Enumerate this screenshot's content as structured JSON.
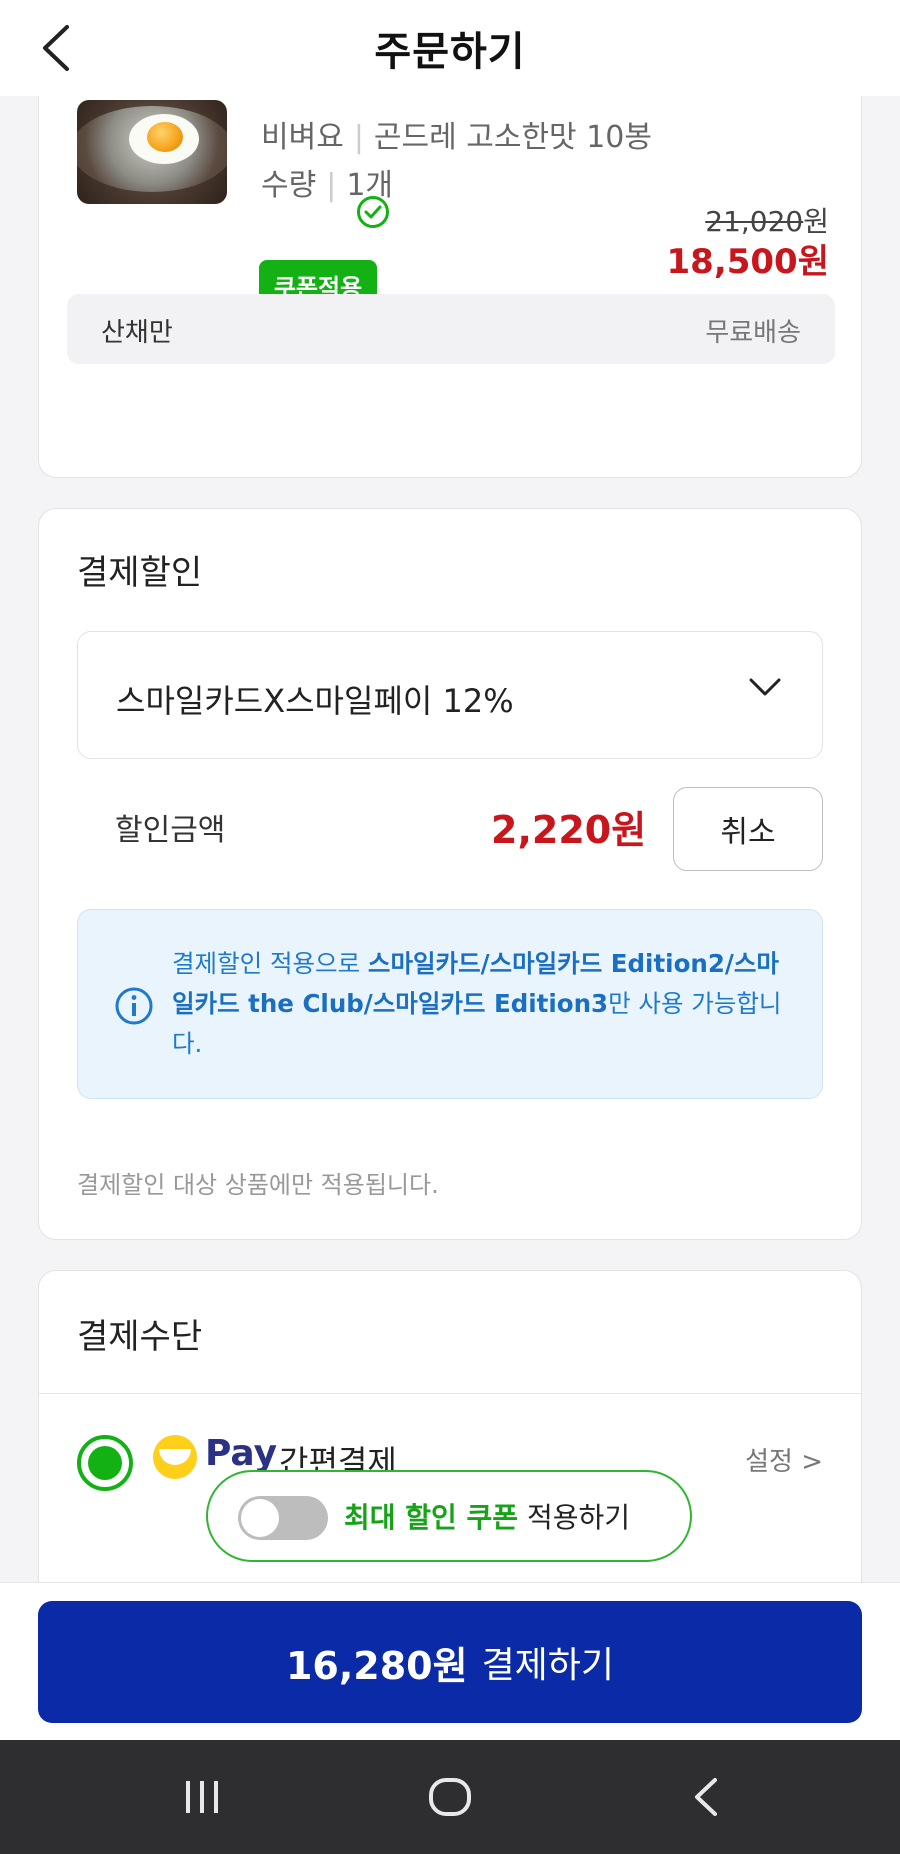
{
  "header": {
    "title": "주문하기"
  },
  "product": {
    "option_label": "비벼요",
    "option_value": "곤드레 고소한맛 10봉",
    "qty_label": "수량",
    "qty_value": "1개",
    "coupon_badge": "쿠폰적용",
    "price_original": "21,020",
    "price_original_unit": "원",
    "price_sale": "18,500원",
    "seller": "산채만",
    "shipping": "무료배송"
  },
  "discount": {
    "title": "결제할인",
    "selected": "스마일카드X스마일페이 12%",
    "amount_label": "할인금액",
    "amount": "2,220원",
    "cancel": "취소",
    "info_prefix": "결제할인 적용으로 ",
    "info_bold": "스마일카드/스마일카드 Edition2/스마일카드 the Club/스마일카드 Edition3",
    "info_suffix": "만 사용 가능합니다.",
    "note": "결제할인 대상 상품에만 적용됩니다."
  },
  "payment": {
    "title": "결제수단",
    "brand": "Pay",
    "method": "간편결제",
    "setting": "설정 >"
  },
  "coupon_toggle": {
    "highlight": "최대 할인 쿠폰",
    "rest": " 적용하기",
    "on": false
  },
  "pay_button": {
    "amount": "16,280원",
    "label": "결제하기"
  },
  "colors": {
    "accent_green": "#13b113",
    "price_red": "#c8161d",
    "pay_blue": "#0a2aa8",
    "info_blue": "#1f7ac9"
  }
}
